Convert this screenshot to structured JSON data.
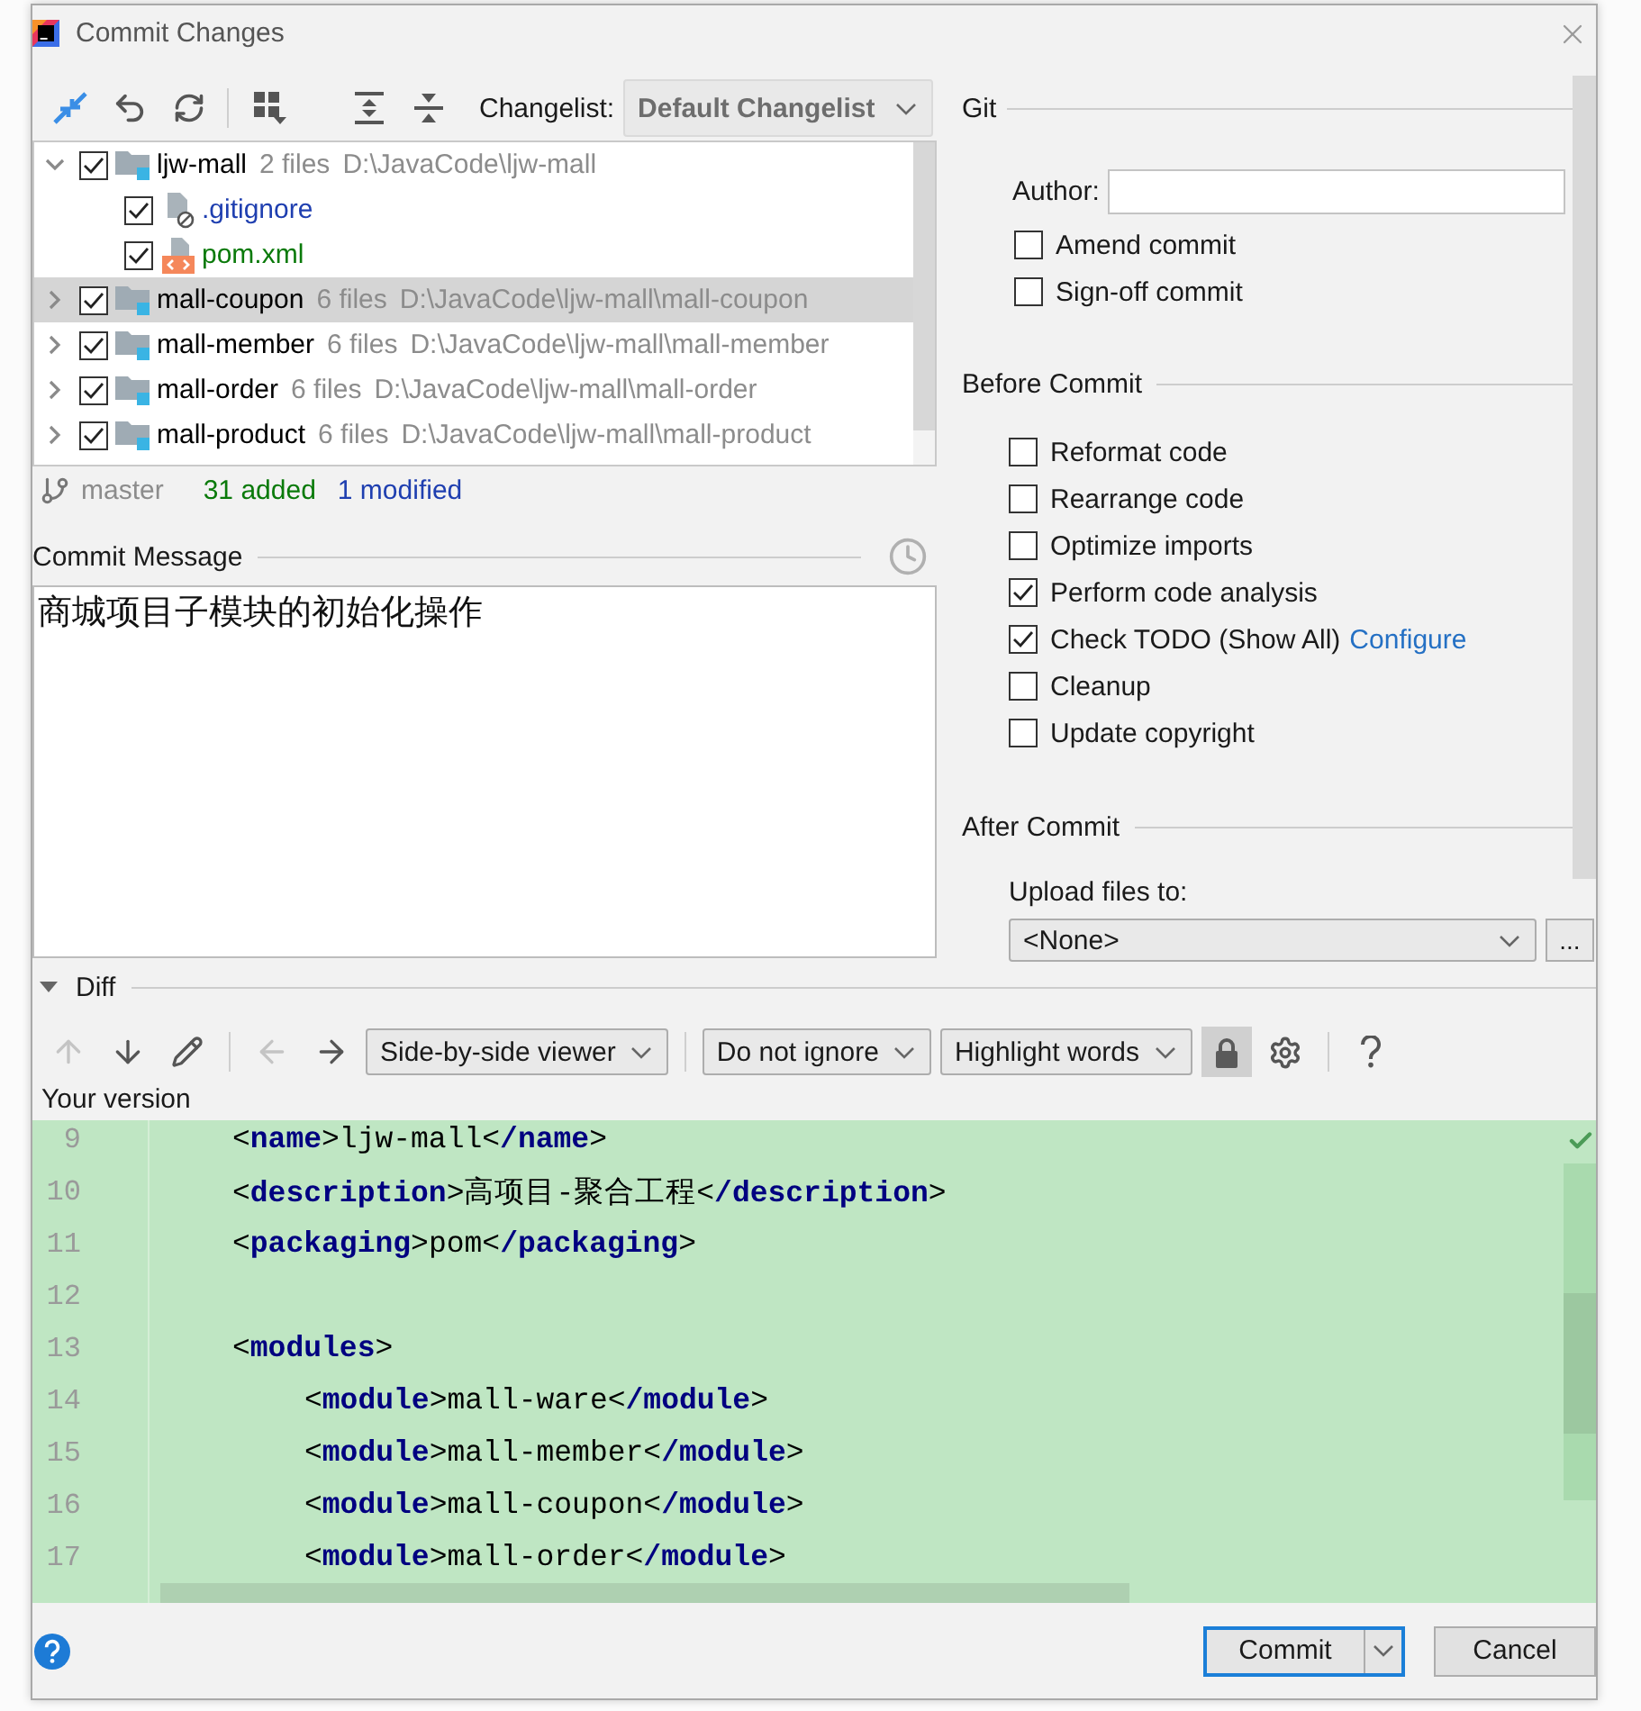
{
  "window": {
    "title": "Commit Changes"
  },
  "changelist": {
    "label": "Changelist:",
    "value": "Default Changelist"
  },
  "changes_tree": {
    "rows": [
      {
        "name": "ljw-mall",
        "kind": "module",
        "count": "2 files",
        "path": "D:\\JavaCode\\ljw-mall",
        "checked": true,
        "expanded": true,
        "selected": false,
        "children": [
          {
            "name": ".gitignore",
            "kind": "ignored",
            "color": "#1f3fb0",
            "checked": true,
            "selected": false
          },
          {
            "name": "pom.xml",
            "kind": "xml",
            "color": "#0a7a0a",
            "checked": true,
            "selected": false
          }
        ]
      },
      {
        "name": "mall-coupon",
        "kind": "module",
        "count": "6 files",
        "path": "D:\\JavaCode\\ljw-mall\\mall-coupon",
        "checked": true,
        "expanded": false,
        "selected": true
      },
      {
        "name": "mall-member",
        "kind": "module",
        "count": "6 files",
        "path": "D:\\JavaCode\\ljw-mall\\mall-member",
        "checked": true,
        "expanded": false,
        "selected": false
      },
      {
        "name": "mall-order",
        "kind": "module",
        "count": "6 files",
        "path": "D:\\JavaCode\\ljw-mall\\mall-order",
        "checked": true,
        "expanded": false,
        "selected": false
      },
      {
        "name": "mall-product",
        "kind": "module",
        "count": "6 files",
        "path": "D:\\JavaCode\\ljw-mall\\mall-product",
        "checked": true,
        "expanded": false,
        "selected": false
      }
    ]
  },
  "status": {
    "branch": "master",
    "added": "31 added",
    "modified": "1 modified"
  },
  "commit_message": {
    "label": "Commit Message",
    "value": "商城项目子模块的初始化操作"
  },
  "git": {
    "title": "Git",
    "author": {
      "label": "Author:"
    },
    "options": [
      {
        "label": "Amend commit",
        "checked": false
      },
      {
        "label": "Sign-off commit",
        "checked": false
      }
    ]
  },
  "before_commit": {
    "title": "Before Commit",
    "options": [
      {
        "label": "Reformat code",
        "checked": false
      },
      {
        "label": "Rearrange code",
        "checked": false
      },
      {
        "label": "Optimize imports",
        "checked": false
      },
      {
        "label": "Perform code analysis",
        "checked": true
      },
      {
        "label": "Check TODO (Show All)",
        "checked": true,
        "link": "Configure"
      },
      {
        "label": "Cleanup",
        "checked": false
      },
      {
        "label": "Update copyright",
        "checked": false
      }
    ]
  },
  "after_commit": {
    "title": "After Commit",
    "upload": {
      "label": "Upload files to:",
      "value": "<None>",
      "button": "..."
    }
  },
  "diff": {
    "title": "Diff",
    "expanded": true,
    "toolbar": [
      {
        "kind": "up",
        "disabled": true
      },
      {
        "kind": "down",
        "disabled": false
      },
      {
        "kind": "edit",
        "disabled": false
      },
      {
        "kind": "separator"
      },
      {
        "kind": "back",
        "disabled": true
      },
      {
        "kind": "forward",
        "disabled": false
      },
      {
        "kind": "select",
        "value": "Side-by-side viewer"
      },
      {
        "kind": "separator"
      },
      {
        "kind": "select",
        "value": "Do not ignore"
      },
      {
        "kind": "select",
        "value": "Highlight words"
      },
      {
        "kind": "lock",
        "on": true
      },
      {
        "kind": "settings",
        "disabled": false
      },
      {
        "kind": "separator"
      },
      {
        "kind": "help",
        "disabled": false
      }
    ],
    "version_label": "Your version",
    "lines": [
      {
        "number": "9",
        "text": "<name>ljw-mall</name>"
      },
      {
        "number": "10",
        "text": "<description>高项目-聚合工程</description>"
      },
      {
        "number": "11",
        "text": "<packaging>pom</packaging>"
      },
      {
        "number": "12"
      },
      {
        "number": "13",
        "text": "<modules>",
        "children": [
          {
            "number": "14",
            "text": "<module>mall-ware</module>"
          },
          {
            "number": "15",
            "text": "<module>mall-member</module>"
          },
          {
            "number": "16",
            "text": "<module>mall-coupon</module>"
          },
          {
            "number": "17",
            "text": "<module>mall-order</module>"
          }
        ]
      }
    ]
  },
  "buttons": {
    "commit": {
      "label": "Commit",
      "focused": true
    },
    "cancel": {
      "label": "Cancel"
    }
  }
}
